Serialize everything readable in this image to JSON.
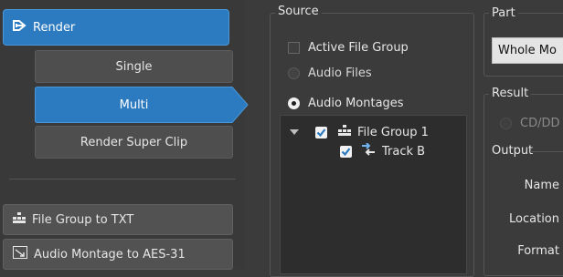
{
  "sidebar": {
    "render_label": "Render",
    "single_label": "Single",
    "multi_label": "Multi",
    "render_super_clip_label": "Render Super Clip",
    "file_group_to_txt_label": "File Group to TXT",
    "audio_montage_to_aes31_label": "Audio Montage to AES-31"
  },
  "source": {
    "title": "Source",
    "options": {
      "active_file_group": "Active File Group",
      "audio_files": "Audio Files",
      "audio_montages": "Audio Montages"
    },
    "selected": "audio_montages",
    "tree": {
      "group_label": "File Group 1",
      "group_checked": true,
      "track_label": "Track B",
      "track_checked": true
    }
  },
  "part": {
    "title": "Part",
    "value": "Whole Mo"
  },
  "result": {
    "title": "Result",
    "cd_option": "CD/DD",
    "output_title": "Output",
    "labels": {
      "name": "Name",
      "location": "Location",
      "format": "Format"
    }
  },
  "colors": {
    "accent": "#2c7bc1",
    "background": "#3b3b3b",
    "button": "#4e4e4e",
    "tree_background": "#2d2d2d"
  }
}
